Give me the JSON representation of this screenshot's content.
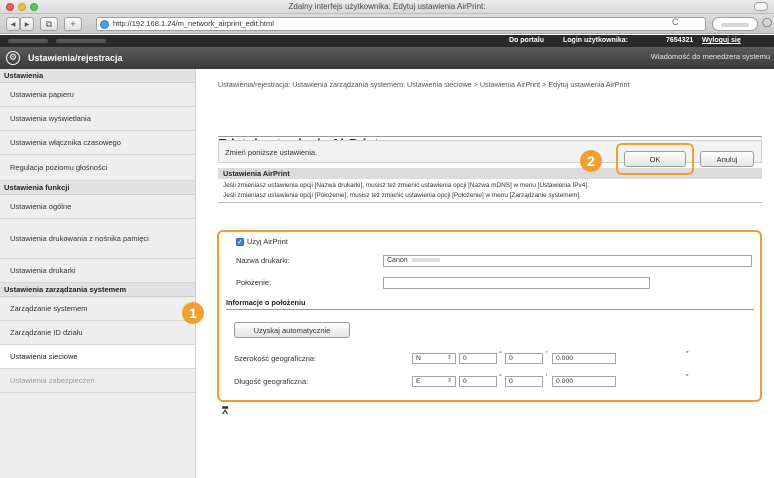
{
  "window": {
    "title": "Zdalny interfejs użytkownika: Edytuj ustawienia AirPrint:"
  },
  "browser": {
    "url": "http://192.168.1.24/m_network_airprint_edit.html",
    "reload_glyph": "C",
    "back_glyph": "◀",
    "forward_glyph": "▶",
    "bookmarks_glyph": "⧉",
    "add_glyph": "+"
  },
  "topbar": {
    "portal_link": "Do portalu",
    "login_label": "Login użytkownika:",
    "login_value": "7654321",
    "logout_link": "Wyloguj się"
  },
  "header": {
    "icon_glyph": "⚙",
    "title": "Ustawienia/rejestracja",
    "message_link": "Wiadomość do menedżera systemu"
  },
  "sidebar": {
    "groups": [
      {
        "heading": "Ustawienia",
        "items": [
          {
            "label": "Ustawienia papieru"
          },
          {
            "label": "Ustawienia wyświetlania"
          },
          {
            "label": "Ustawienia włącznika czasowego"
          },
          {
            "label": "Regulacja poziomu głośności"
          }
        ]
      },
      {
        "heading": "Ustawienia funkcji",
        "items": [
          {
            "label": "Ustawienia ogólne"
          },
          {
            "label": "Ustawienia drukowania z nośnika pamięci"
          },
          {
            "label": "Ustawienia drukarki"
          }
        ]
      },
      {
        "heading": "Ustawienia zarządzania systemem",
        "items": [
          {
            "label": "Zarządzanie systemem"
          },
          {
            "label": "Zarządzanie ID działu"
          },
          {
            "label": "Ustawienia sieciowe"
          },
          {
            "label": "Ustawienia zabezpieczeń"
          }
        ]
      }
    ]
  },
  "breadcrumb": "Ustawienia/rejestracja: Ustawienia zarządzania systemem: Ustawienia sieciowe > Ustawienia AirPrint > Edytuj ustawienia AirPrint",
  "page_title": "Edytuj ustawienia AirPrint",
  "action_bar": {
    "instruction": "Zmień poniższe ustawienia.",
    "ok_label": "OK",
    "cancel_label": "Anuluj"
  },
  "airprint": {
    "section_title": "Ustawienia AirPrint",
    "note_1": "Jeśli zmieniasz ustawienia opcji [Nazwa drukarki], musisz też zmienić ustawienia opcji [Nazwa mDNS] w menu [Ustawienia IPv4].",
    "note_2": "Jeśli zmieniasz ustawienia opcji [Położenie], musisz też zmienić ustawienia opcji [Położenie] w menu [Zarządzanie systemem].",
    "use_airprint_label": "Użyj AirPrint",
    "use_airprint_checked": true,
    "printer_name_label": "Nazwa drukarki:",
    "printer_name_value": "Canon",
    "location_label": "Położenie:",
    "location_value": ""
  },
  "location_info": {
    "title": "Informacje o położeniu",
    "auto_button": "Uzyskaj automatycznie",
    "latitude_label": "Szerokość geograficzna:",
    "latitude_dir": "N",
    "latitude_deg": "0",
    "latitude_min": "0",
    "latitude_sec": "0.000",
    "longitude_label": "Długość geograficzna:",
    "longitude_dir": "E",
    "longitude_deg": "0",
    "longitude_min": "0",
    "longitude_sec": "0.000",
    "degree_mark": "°",
    "minute_mark": "′",
    "second_mark": "″"
  },
  "callouts": {
    "one": "1",
    "two": "2"
  },
  "page_top_glyph": "⩞",
  "colors": {
    "callout": "#f0a030",
    "header_bg": "#3a3a3a",
    "topbar_bg": "#2a2a2a",
    "sidebar_bg": "#eeeeee",
    "checkbox": "#3d84d6"
  }
}
